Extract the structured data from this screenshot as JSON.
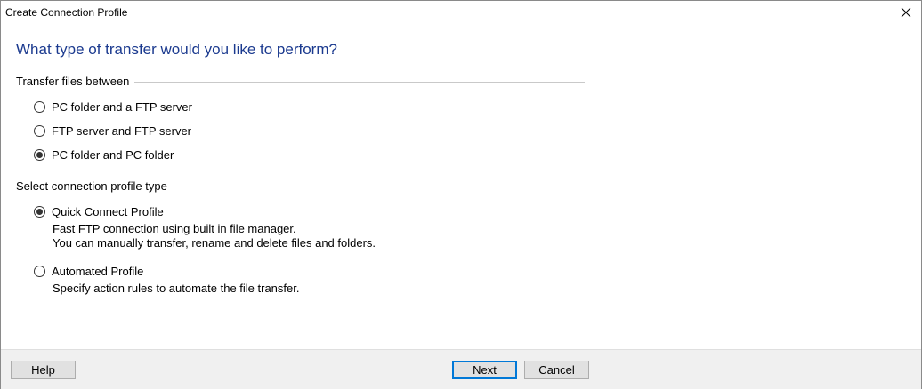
{
  "window": {
    "title": "Create Connection Profile"
  },
  "heading": "What type of transfer would you like to perform?",
  "transfer_group": {
    "label": "Transfer files between",
    "options": [
      {
        "label": "PC folder and a FTP server",
        "checked": false
      },
      {
        "label": "FTP server and FTP server",
        "checked": false
      },
      {
        "label": "PC folder and PC folder",
        "checked": true
      }
    ]
  },
  "profile_group": {
    "label": "Select connection profile type",
    "options": [
      {
        "label": "Quick Connect Profile",
        "checked": true,
        "desc1": "Fast FTP connection using built in file manager.",
        "desc2": "You can manually transfer, rename and delete files and folders."
      },
      {
        "label": "Automated Profile",
        "checked": false,
        "desc1": "Specify action rules to automate the file transfer."
      }
    ]
  },
  "buttons": {
    "help": "Help",
    "next": "Next",
    "cancel": "Cancel"
  },
  "icons": {
    "close": "close-icon"
  },
  "colors": {
    "heading": "#1b3a8f",
    "default_button_border": "#0078d7",
    "footer_bg": "#f0f0f0"
  }
}
